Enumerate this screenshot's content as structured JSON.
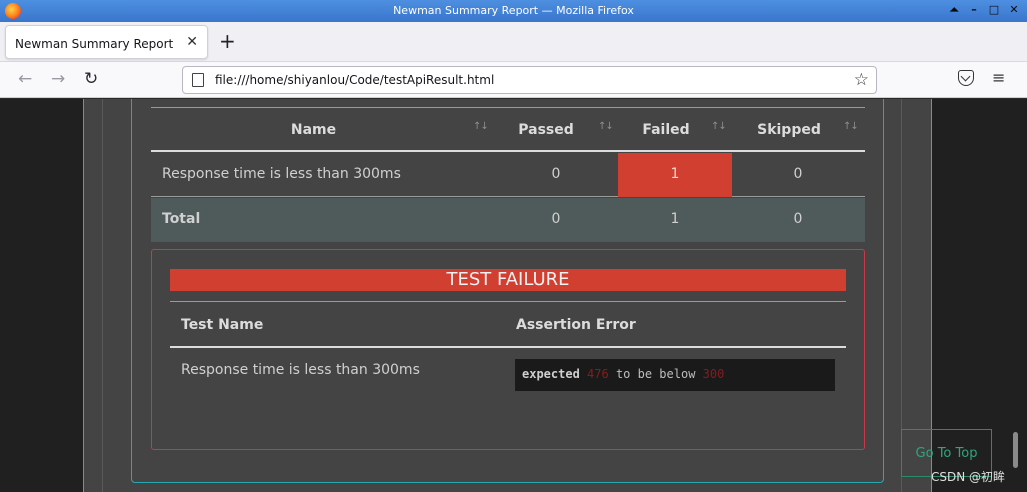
{
  "window": {
    "title": "Newman Summary Report — Mozilla Firefox",
    "controls": [
      "⏶",
      "–",
      "□",
      "✕"
    ]
  },
  "tabs": [
    {
      "label": "Newman Summary Report",
      "close": "✕"
    }
  ],
  "newtab_label": "+",
  "nav": {
    "back": "←",
    "forward": "→",
    "reload": "↻",
    "url": "file:///home/shiyanlou/Code/testApiResult.html",
    "bookmark": "☆",
    "menu": "≡"
  },
  "summary": {
    "headers": {
      "name": "Name",
      "passed": "Passed",
      "failed": "Failed",
      "skipped": "Skipped"
    },
    "sort_glyph": "↑↓",
    "rows": [
      {
        "name": "Response time is less than 300ms",
        "passed": "0",
        "failed": "1",
        "skipped": "0"
      }
    ],
    "total": {
      "name": "Total",
      "passed": "0",
      "failed": "1",
      "skipped": "0"
    }
  },
  "failure": {
    "banner": "TEST FAILURE",
    "headers": {
      "test_name": "Test Name",
      "assertion_error": "Assertion Error"
    },
    "test_name": "Response time is less than 300ms",
    "assertion": {
      "keyword": "expected",
      "actual": "476",
      "middle": "to be below",
      "limit": "300"
    }
  },
  "go_to_top": "Go To Top",
  "watermark": "CSDN @初眸",
  "colors": {
    "failed": "#d13f31",
    "border_accent": "#2aa8b0",
    "failure_border": "#c8394a",
    "total_row": "#4f5a5a",
    "go_to_top": "#2fa67a"
  }
}
